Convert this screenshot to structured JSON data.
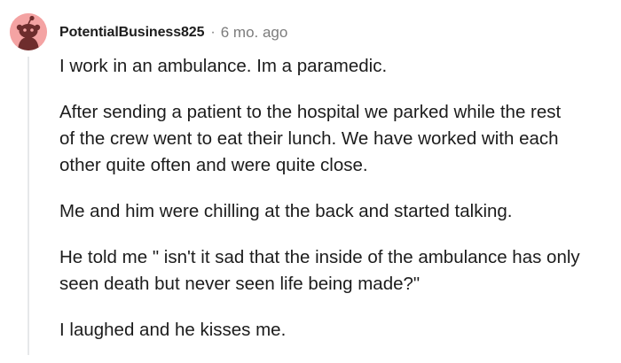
{
  "comment": {
    "username": "PotentialBusiness825",
    "separator": "·",
    "timestamp": "6 mo. ago",
    "paragraphs": [
      [
        "I work in an ambulance. Im a paramedic."
      ],
      [
        "After sending a patient to the hospital we parked while the rest",
        "of the crew went to eat their lunch. We have worked with each",
        "other quite often and were quite close."
      ],
      [
        "Me and him were chilling at the back and started talking."
      ],
      [
        "He told me \" isn't it sad that the inside of the ambulance has only",
        "seen death but never seen life being made?\""
      ],
      [
        "I laughed and he kisses me."
      ]
    ]
  },
  "avatar": {
    "icon": "snoo-avatar-icon",
    "background_color": "#F4A3A3"
  },
  "colors": {
    "text": "#1C1C1C",
    "meta": "#7C7C7C",
    "thread_line": "#E6E8EA"
  }
}
